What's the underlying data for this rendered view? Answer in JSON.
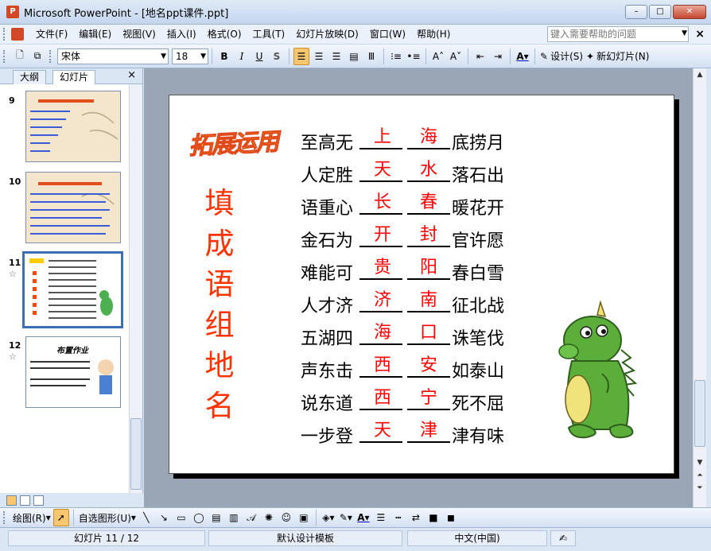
{
  "window": {
    "title": "Microsoft PowerPoint - [地名ppt课件.ppt]"
  },
  "menu": {
    "items": [
      "文件(F)",
      "编辑(E)",
      "视图(V)",
      "插入(I)",
      "格式(O)",
      "工具(T)",
      "幻灯片放映(D)",
      "窗口(W)",
      "帮助(H)"
    ],
    "help_placeholder": "键入需要帮助的问题"
  },
  "toolbar": {
    "font": "宋体",
    "size": "18",
    "bold": "B",
    "italic": "I",
    "underline": "U",
    "shadow": "S",
    "design": "设计(S)",
    "new_slide": "新幻灯片(N)"
  },
  "panel": {
    "tab_outline": "大纲",
    "tab_slides": "幻灯片",
    "slides": [
      {
        "num": "9"
      },
      {
        "num": "10"
      },
      {
        "num": "11"
      },
      {
        "num": "12",
        "title": "布置作业"
      }
    ]
  },
  "slide": {
    "heading": "拓展运用",
    "vertical_title": [
      "填",
      "成",
      "语",
      "组",
      "地",
      "名"
    ],
    "idioms": [
      {
        "a": "至高无",
        "ans1": "上",
        "ans2": "海",
        "b": "底捞月"
      },
      {
        "a": "人定胜",
        "ans1": "天",
        "ans2": "水",
        "b": "落石出"
      },
      {
        "a": "语重心",
        "ans1": "长",
        "ans2": "春",
        "b": "暖花开"
      },
      {
        "a": "金石为",
        "ans1": "开",
        "ans2": "封",
        "b": "官许愿"
      },
      {
        "a": "难能可",
        "ans1": "贵",
        "ans2": "阳",
        "b": "春白雪"
      },
      {
        "a": "人才济",
        "ans1": "济",
        "ans2": "南",
        "b": "征北战"
      },
      {
        "a": "五湖四",
        "ans1": "海",
        "ans2": "口",
        "b": "诛笔伐"
      },
      {
        "a": "声东击",
        "ans1": "西",
        "ans2": "安",
        "b": "如泰山"
      },
      {
        "a": "说东道",
        "ans1": "西",
        "ans2": "宁",
        "b": "死不屈"
      },
      {
        "a": "一步登",
        "ans1": "天",
        "ans2": "津",
        "b": "津有味"
      }
    ]
  },
  "drawbar": {
    "draw": "绘图(R)",
    "autoshape": "自选图形(U)"
  },
  "status": {
    "slide": "幻灯片 11 / 12",
    "template": "默认设计模板",
    "lang": "中文(中国)"
  },
  "colors": {
    "accent": "#ff3300",
    "answer": "#ff0000",
    "heading": "#ffcc00"
  }
}
